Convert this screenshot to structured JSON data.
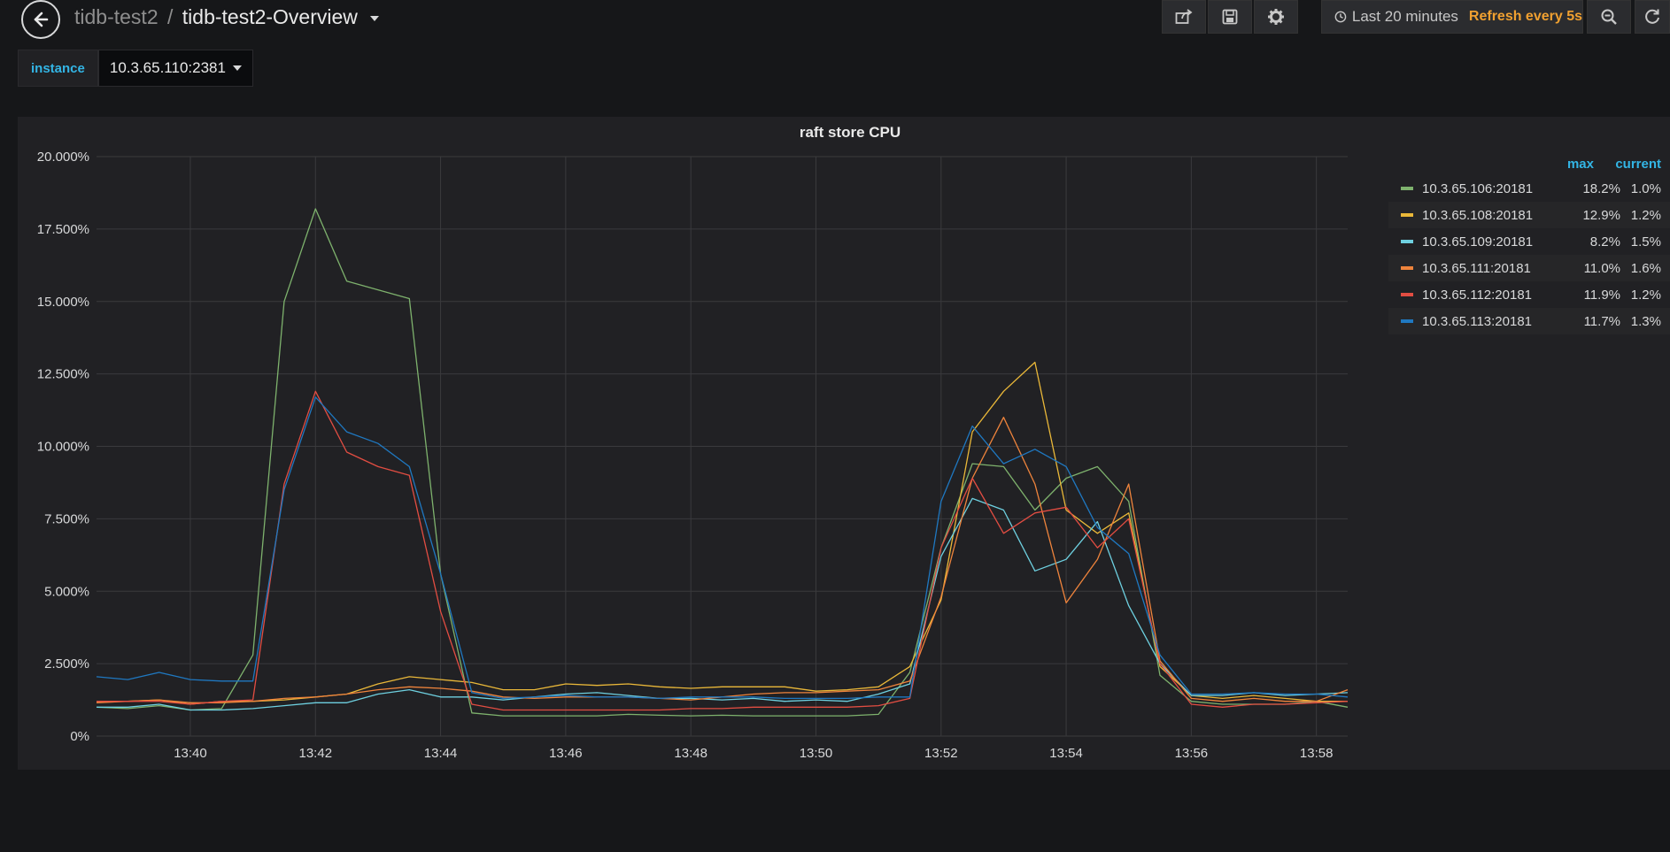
{
  "breadcrumb": {
    "folder": "tidb-test2",
    "separator": "/",
    "dashboard_title": "tidb-test2-Overview"
  },
  "toolbar": {
    "share_icon": "share-icon",
    "save_icon": "save-icon",
    "settings_icon": "gear-icon",
    "time_range": "Last 20 minutes",
    "refresh_label": "Refresh every 5s",
    "zoom_out_icon": "zoom-out-icon",
    "refresh_icon": "refresh-icon"
  },
  "variables": {
    "instance_label": "instance",
    "instance_value": "10.3.65.110:2381"
  },
  "panel": {
    "title": "raft store CPU"
  },
  "legend": {
    "col_max": "max",
    "col_current": "current",
    "rows": [
      {
        "name": "10.3.65.106:20181",
        "max": "18.2%",
        "current": "1.0%",
        "color": "#7eb26d"
      },
      {
        "name": "10.3.65.108:20181",
        "max": "12.9%",
        "current": "1.2%",
        "color": "#eab839"
      },
      {
        "name": "10.3.65.109:20181",
        "max": "8.2%",
        "current": "1.5%",
        "color": "#6ed0e0"
      },
      {
        "name": "10.3.65.111:20181",
        "max": "11.0%",
        "current": "1.6%",
        "color": "#ef843c"
      },
      {
        "name": "10.3.65.112:20181",
        "max": "11.9%",
        "current": "1.2%",
        "color": "#e24d42"
      },
      {
        "name": "10.3.65.113:20181",
        "max": "11.7%",
        "current": "1.3%",
        "color": "#1f78c1"
      }
    ]
  },
  "chart_data": {
    "type": "line",
    "title": "raft store CPU",
    "xlabel": "",
    "ylabel": "",
    "ylim": [
      0,
      20
    ],
    "xlim": [
      "13:38:30",
      "13:58:30"
    ],
    "y_ticks": [
      "0%",
      "2.500%",
      "5.000%",
      "7.500%",
      "10.000%",
      "12.500%",
      "15.000%",
      "17.500%",
      "20.000%"
    ],
    "x_ticks": [
      "13:40",
      "13:42",
      "13:44",
      "13:46",
      "13:48",
      "13:50",
      "13:52",
      "13:54",
      "13:56",
      "13:58"
    ],
    "grid": true,
    "legend_position": "right",
    "x": [
      "13:38:30",
      "13:39:00",
      "13:39:30",
      "13:40:00",
      "13:40:30",
      "13:41:00",
      "13:41:30",
      "13:42:00",
      "13:42:30",
      "13:43:00",
      "13:43:30",
      "13:44:00",
      "13:44:30",
      "13:45:00",
      "13:45:30",
      "13:46:00",
      "13:46:30",
      "13:47:00",
      "13:47:30",
      "13:48:00",
      "13:48:30",
      "13:49:00",
      "13:49:30",
      "13:50:00",
      "13:50:30",
      "13:51:00",
      "13:51:30",
      "13:52:00",
      "13:52:30",
      "13:53:00",
      "13:53:30",
      "13:54:00",
      "13:54:30",
      "13:55:00",
      "13:55:30",
      "13:56:00",
      "13:56:30",
      "13:57:00",
      "13:57:30",
      "13:58:00",
      "13:58:30"
    ],
    "series": [
      {
        "name": "10.3.65.106:20181",
        "color": "#7eb26d",
        "values": [
          1.0,
          0.95,
          1.05,
          0.9,
          0.95,
          2.8,
          15.0,
          18.2,
          15.7,
          15.4,
          15.1,
          5.6,
          0.8,
          0.7,
          0.7,
          0.7,
          0.7,
          0.75,
          0.72,
          0.7,
          0.72,
          0.7,
          0.7,
          0.7,
          0.7,
          0.75,
          2.2,
          6.5,
          9.4,
          9.3,
          7.8,
          8.9,
          9.3,
          8.1,
          2.1,
          1.2,
          1.1,
          1.1,
          1.1,
          1.2,
          1.0
        ]
      },
      {
        "name": "10.3.65.108:20181",
        "color": "#eab839",
        "values": [
          1.2,
          1.2,
          1.25,
          1.1,
          1.2,
          1.2,
          1.25,
          1.35,
          1.45,
          1.8,
          2.05,
          1.95,
          1.85,
          1.6,
          1.6,
          1.8,
          1.75,
          1.8,
          1.7,
          1.65,
          1.7,
          1.7,
          1.7,
          1.55,
          1.6,
          1.7,
          2.4,
          4.7,
          10.5,
          11.9,
          12.9,
          7.8,
          7.0,
          7.7,
          2.4,
          1.4,
          1.3,
          1.4,
          1.3,
          1.2,
          1.2
        ]
      },
      {
        "name": "10.3.65.109:20181",
        "color": "#6ed0e0",
        "values": [
          1.0,
          1.0,
          1.1,
          0.9,
          0.9,
          0.95,
          1.05,
          1.15,
          1.15,
          1.45,
          1.6,
          1.35,
          1.35,
          1.25,
          1.35,
          1.45,
          1.5,
          1.4,
          1.3,
          1.3,
          1.25,
          1.3,
          1.2,
          1.25,
          1.2,
          1.45,
          1.8,
          6.2,
          8.2,
          7.8,
          5.7,
          6.1,
          7.4,
          4.5,
          2.5,
          1.4,
          1.4,
          1.5,
          1.4,
          1.45,
          1.5
        ]
      },
      {
        "name": "10.3.65.111:20181",
        "color": "#ef843c",
        "values": [
          1.15,
          1.2,
          1.25,
          1.15,
          1.15,
          1.2,
          1.3,
          1.35,
          1.45,
          1.6,
          1.7,
          1.65,
          1.55,
          1.35,
          1.3,
          1.35,
          1.35,
          1.35,
          1.3,
          1.25,
          1.35,
          1.45,
          1.5,
          1.5,
          1.55,
          1.6,
          1.9,
          4.8,
          8.9,
          11.0,
          8.7,
          4.6,
          6.1,
          8.7,
          2.6,
          1.3,
          1.2,
          1.3,
          1.2,
          1.2,
          1.6
        ]
      },
      {
        "name": "10.3.65.112:20181",
        "color": "#e24d42",
        "values": [
          1.2,
          1.2,
          1.2,
          1.1,
          1.2,
          1.25,
          8.7,
          11.9,
          9.8,
          9.3,
          9.0,
          4.3,
          1.1,
          0.9,
          0.9,
          0.9,
          0.9,
          0.9,
          0.9,
          0.95,
          0.95,
          1.0,
          1.0,
          1.0,
          1.0,
          1.05,
          1.3,
          6.5,
          8.9,
          7.0,
          7.7,
          7.9,
          6.5,
          7.5,
          2.5,
          1.1,
          1.0,
          1.1,
          1.1,
          1.15,
          1.2
        ]
      },
      {
        "name": "10.3.65.113:20181",
        "color": "#1f78c1",
        "values": [
          2.05,
          1.95,
          2.2,
          1.95,
          1.9,
          1.9,
          8.5,
          11.7,
          10.5,
          10.1,
          9.3,
          5.6,
          1.5,
          1.3,
          1.35,
          1.4,
          1.35,
          1.35,
          1.3,
          1.35,
          1.35,
          1.35,
          1.3,
          1.3,
          1.3,
          1.35,
          1.35,
          8.1,
          10.7,
          9.4,
          9.9,
          9.3,
          7.2,
          6.3,
          2.8,
          1.45,
          1.45,
          1.5,
          1.45,
          1.45,
          1.35
        ]
      }
    ]
  }
}
